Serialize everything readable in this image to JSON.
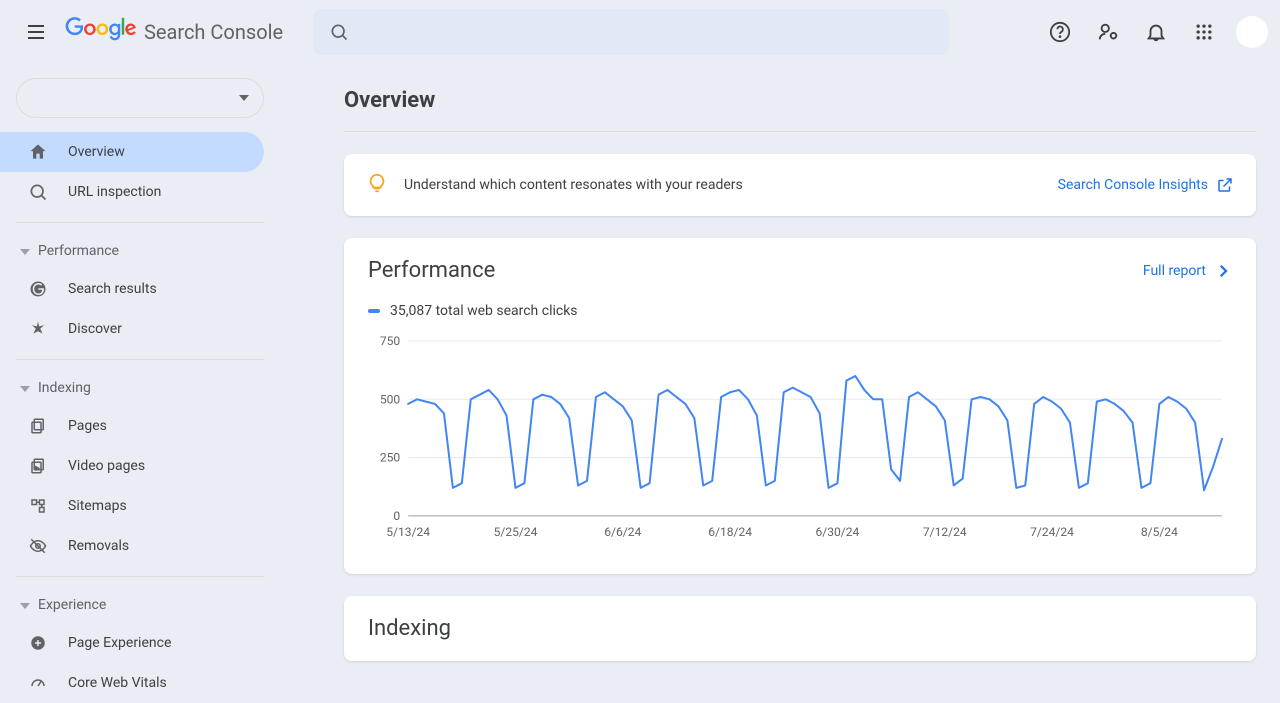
{
  "header": {
    "product_name": "Search Console",
    "search_placeholder": ""
  },
  "sidebar": {
    "items_primary": [
      {
        "id": "overview",
        "label": "Overview"
      },
      {
        "id": "url-inspection",
        "label": "URL inspection"
      }
    ],
    "sections": {
      "performance": {
        "label": "Performance",
        "items": [
          {
            "id": "search-results",
            "label": "Search results"
          },
          {
            "id": "discover",
            "label": "Discover"
          }
        ]
      },
      "indexing": {
        "label": "Indexing",
        "items": [
          {
            "id": "pages",
            "label": "Pages"
          },
          {
            "id": "video-pages",
            "label": "Video pages"
          },
          {
            "id": "sitemaps",
            "label": "Sitemaps"
          },
          {
            "id": "removals",
            "label": "Removals"
          }
        ]
      },
      "experience": {
        "label": "Experience",
        "items": [
          {
            "id": "page-experience",
            "label": "Page Experience"
          },
          {
            "id": "core-web-vitals",
            "label": "Core Web Vitals"
          }
        ]
      }
    }
  },
  "main": {
    "title": "Overview",
    "insights": {
      "text": "Understand which content resonates with your readers",
      "link_label": "Search Console Insights"
    },
    "performance": {
      "title": "Performance",
      "full_report_label": "Full report",
      "legend": "35,087 total web search clicks"
    },
    "indexing": {
      "title": "Indexing"
    }
  },
  "chart_data": {
    "type": "line",
    "title": "Performance",
    "xlabel": "",
    "ylabel": "",
    "ylim": [
      0,
      750
    ],
    "yticks": [
      0,
      250,
      500,
      750
    ],
    "xticks": [
      "5/13/24",
      "5/25/24",
      "6/6/24",
      "6/18/24",
      "6/30/24",
      "7/12/24",
      "7/24/24",
      "8/5/24"
    ],
    "series": [
      {
        "name": "total web search clicks",
        "color": "#4285f4",
        "x": [
          "5/13/24",
          "5/14/24",
          "5/15/24",
          "5/16/24",
          "5/17/24",
          "5/18/24",
          "5/19/24",
          "5/20/24",
          "5/21/24",
          "5/22/24",
          "5/23/24",
          "5/24/24",
          "5/25/24",
          "5/26/24",
          "5/27/24",
          "5/28/24",
          "5/29/24",
          "5/30/24",
          "5/31/24",
          "6/1/24",
          "6/2/24",
          "6/3/24",
          "6/4/24",
          "6/5/24",
          "6/6/24",
          "6/7/24",
          "6/8/24",
          "6/9/24",
          "6/10/24",
          "6/11/24",
          "6/12/24",
          "6/13/24",
          "6/14/24",
          "6/15/24",
          "6/16/24",
          "6/17/24",
          "6/18/24",
          "6/19/24",
          "6/20/24",
          "6/21/24",
          "6/22/24",
          "6/23/24",
          "6/24/24",
          "6/25/24",
          "6/26/24",
          "6/27/24",
          "6/28/24",
          "6/29/24",
          "6/30/24",
          "7/1/24",
          "7/2/24",
          "7/3/24",
          "7/4/24",
          "7/5/24",
          "7/6/24",
          "7/7/24",
          "7/8/24",
          "7/9/24",
          "7/10/24",
          "7/11/24",
          "7/12/24",
          "7/13/24",
          "7/14/24",
          "7/15/24",
          "7/16/24",
          "7/17/24",
          "7/18/24",
          "7/19/24",
          "7/20/24",
          "7/21/24",
          "7/22/24",
          "7/23/24",
          "7/24/24",
          "7/25/24",
          "7/26/24",
          "7/27/24",
          "7/28/24",
          "7/29/24",
          "7/30/24",
          "7/31/24",
          "8/1/24",
          "8/2/24",
          "8/3/24",
          "8/4/24",
          "8/5/24",
          "8/6/24",
          "8/7/24",
          "8/8/24",
          "8/9/24",
          "8/10/24",
          "8/11/24",
          "8/12/24"
        ],
        "values": [
          480,
          500,
          490,
          480,
          440,
          120,
          140,
          500,
          520,
          540,
          500,
          430,
          120,
          140,
          500,
          520,
          510,
          480,
          420,
          130,
          150,
          510,
          530,
          500,
          470,
          410,
          120,
          140,
          520,
          540,
          510,
          480,
          420,
          130,
          150,
          510,
          530,
          540,
          500,
          430,
          130,
          150,
          530,
          550,
          530,
          510,
          440,
          120,
          140,
          580,
          600,
          540,
          500,
          500,
          200,
          150,
          510,
          530,
          500,
          470,
          410,
          130,
          160,
          500,
          510,
          500,
          470,
          410,
          120,
          130,
          480,
          510,
          490,
          460,
          400,
          120,
          140,
          490,
          500,
          480,
          450,
          400,
          120,
          140,
          480,
          510,
          490,
          460,
          400,
          110,
          210,
          330
        ]
      }
    ]
  }
}
